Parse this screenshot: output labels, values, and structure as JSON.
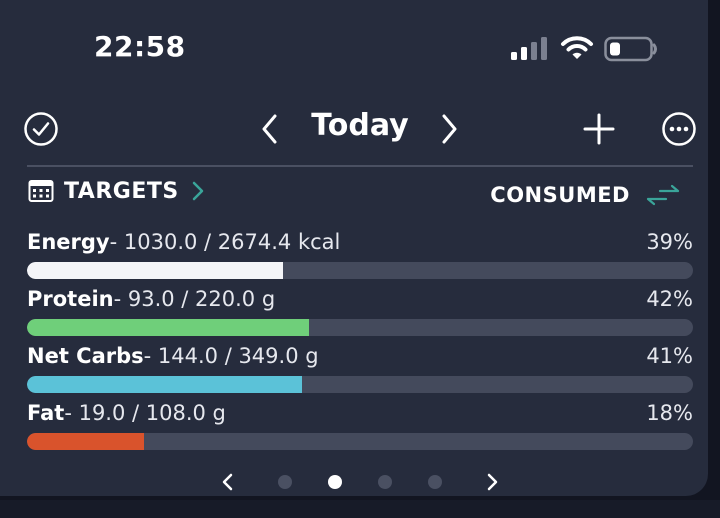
{
  "status_bar": {
    "time": "22:58",
    "icons": [
      "cellular-signal-icon",
      "wifi-icon",
      "battery-icon"
    ]
  },
  "header": {
    "title": "Today",
    "left_icon": "checkmark-circle-icon",
    "prev_icon": "chevron-left-icon",
    "next_icon": "chevron-right-icon",
    "add_icon": "plus-icon",
    "more_icon": "ellipsis-circle-icon"
  },
  "targets_row": {
    "targets_label": "TARGETS",
    "consumed_label": "CONSUMED",
    "calendar_icon": "calendar-icon",
    "swap_icon": "swap-arrows-icon"
  },
  "nutrients": [
    {
      "name": "Energy",
      "detail": "- 1030.0 / 2674.4 kcal",
      "percent_label": "39%",
      "progress": 0.385,
      "color": "#f4f5f8"
    },
    {
      "name": "Protein",
      "detail": "- 93.0 / 220.0 g",
      "percent_label": "42%",
      "progress": 0.423,
      "color": "#6fcf7a"
    },
    {
      "name": "Net Carbs",
      "detail": "- 144.0 / 349.0 g",
      "percent_label": "41%",
      "progress": 0.413,
      "color": "#5bc2d8"
    },
    {
      "name": "Fat",
      "detail": "- 19.0 / 108.0 g",
      "percent_label": "18%",
      "progress": 0.176,
      "color": "#d9532c"
    }
  ],
  "pager": {
    "page_count": 4,
    "active_index": 1
  },
  "colors": {
    "background": "#262c3d",
    "track": "#444a5c",
    "accent_teal": "#3aa59a"
  }
}
